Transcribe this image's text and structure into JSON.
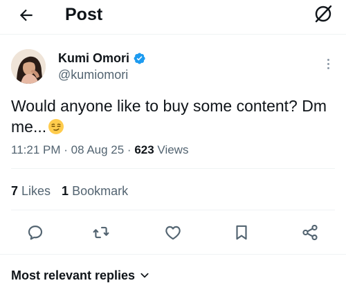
{
  "header": {
    "title": "Post"
  },
  "author": {
    "name": "Kumi Omori",
    "handle": "@kumiomori",
    "verified": true
  },
  "tweet": {
    "text": "Would anyone like to buy some content? Dm me...",
    "emoji": "smirking-face"
  },
  "meta": {
    "time": "11:21 PM",
    "sep1": " · ",
    "date": "08 Aug 25",
    "sep2": " · ",
    "views_count": "623",
    "views_label": " Views"
  },
  "stats": {
    "likes_count": "7",
    "likes_label": " Likes",
    "bookmarks_count": "1",
    "bookmarks_label": " Bookmark"
  },
  "actions": [
    "reply-icon",
    "repost-icon",
    "like-icon",
    "bookmark-icon",
    "share-icon"
  ],
  "replies": {
    "sort_label": "Most relevant replies"
  },
  "colors": {
    "text_primary": "#0f1419",
    "text_secondary": "#536471",
    "verified_blue": "#1d9bf0",
    "divider": "#eff3f4"
  }
}
